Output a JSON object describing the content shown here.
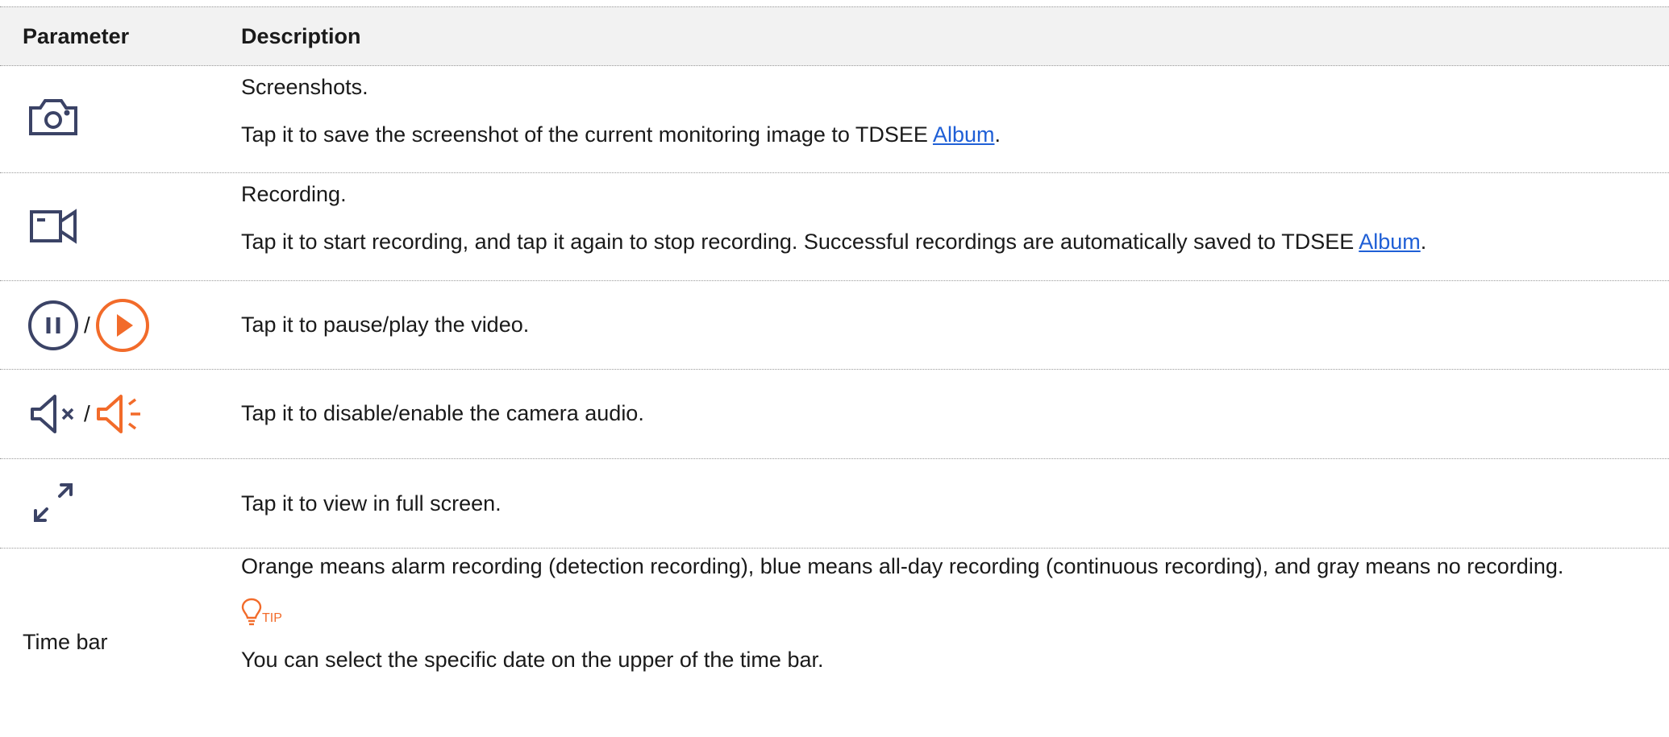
{
  "header": {
    "param": "Parameter",
    "desc": "Description"
  },
  "rows": [
    {
      "icon": "camera-icon",
      "title": "Screenshots.",
      "text": "Tap it to save the screenshot of the current monitoring image to TDSEE",
      "link": "Album",
      "end": "."
    },
    {
      "icon": "video-camera-icon",
      "title": "Recording.",
      "text": "Tap it to start recording, and tap it again to stop recording. Successful recordings are automatically saved to TDSEE",
      "link": "Album",
      "end": "."
    },
    {
      "icons": [
        "pause-icon",
        "play-icon"
      ],
      "slash": "/",
      "text": "Tap it to pause/play the video."
    },
    {
      "icons": [
        "speaker-muted-icon",
        "speaker-on-icon"
      ],
      "slash": "/",
      "text": "Tap it to disable/enable the camera audio."
    },
    {
      "icon": "fullscreen-icon",
      "text": "Tap it to view in full screen."
    },
    {
      "param": "Time bar",
      "text": "Orange means alarm recording (detection recording), blue means all-day recording (continuous recording), and gray means no recording.",
      "tip_label": "TIP",
      "tip_text": "You can select the specific date on the upper of the time bar."
    }
  ],
  "colors": {
    "icon": "#3b4366",
    "accent": "#f26b2a",
    "link": "#1f5fd6",
    "header_bg": "#f2f2f2"
  }
}
